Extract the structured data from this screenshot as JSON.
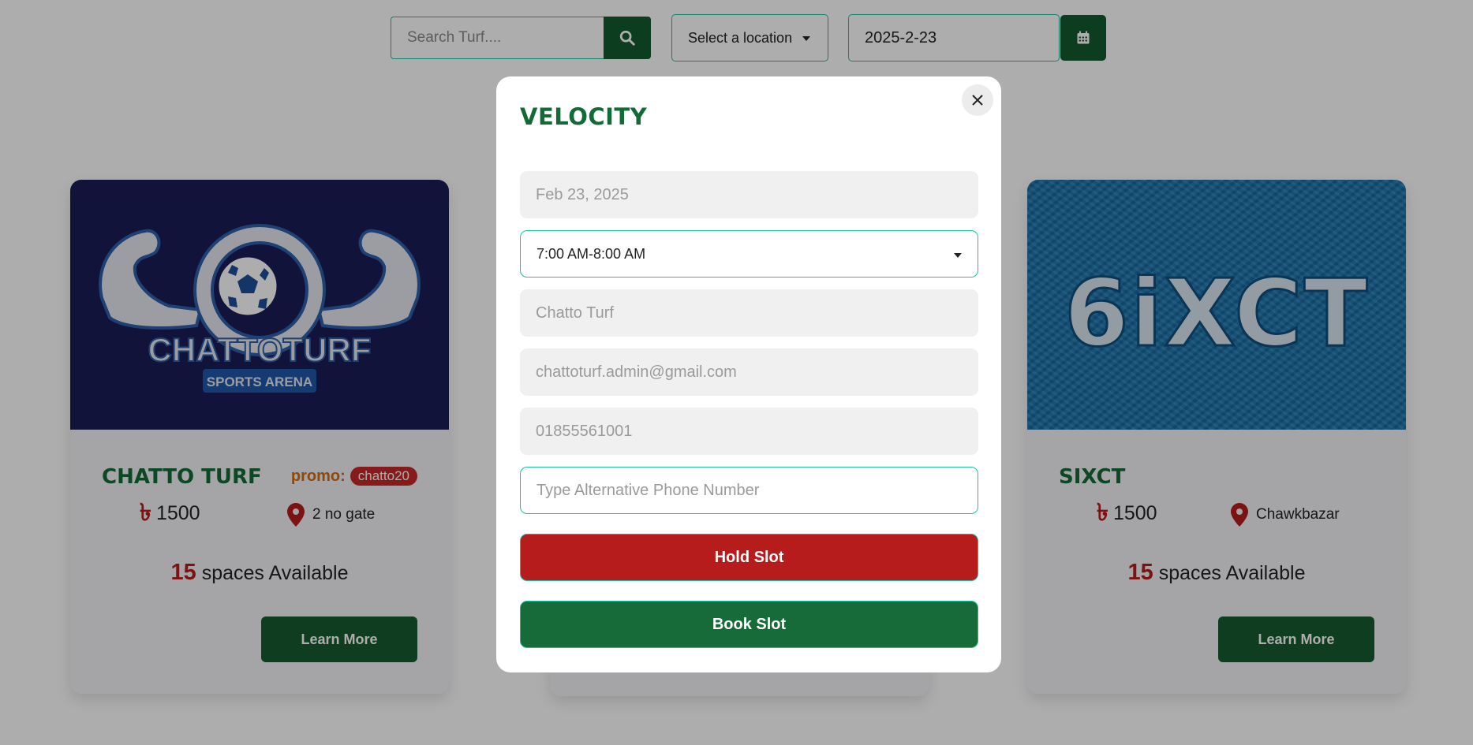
{
  "search": {
    "placeholder": "Search Turf...."
  },
  "filters": {
    "location_label": "Select a location",
    "date_value": "2025-2-23"
  },
  "cards": [
    {
      "title": "CHATTO TURF",
      "promo_label": "promo:",
      "promo_code": "chatto20",
      "price": "1500",
      "location": "2 no gate",
      "spaces_count": "15",
      "spaces_text": "spaces Available",
      "button": "Learn More",
      "logo_text_main": "CHATTOTURF",
      "logo_text_sub": "SPORTS ARENA"
    },
    {
      "title": "SIXCT",
      "price": "1500",
      "location": "Chawkbazar",
      "spaces_count": "15",
      "spaces_text": "spaces Available",
      "button": "Learn More",
      "logo_text_main": "6iXCT"
    }
  ],
  "modal": {
    "title": "VELOCITY",
    "date": "Feb 23, 2025",
    "time_slot": "7:00 AM-8:00 AM",
    "turf_name": "Chatto Turf",
    "email": "chattoturf.admin@gmail.com",
    "phone": "01855561001",
    "alt_phone_placeholder": "Type Alternative Phone Number",
    "hold_button": "Hold Slot",
    "book_button": "Book Slot"
  },
  "icons": {
    "currency": "৳",
    "search": "search-icon",
    "calendar": "calendar-icon",
    "location": "map-pin-icon",
    "close": "close-icon"
  },
  "colors": {
    "brand_green": "#136a36",
    "accent_teal": "#1ebfa0",
    "danger_red": "#b71c1c",
    "promo_orange": "#d26a12"
  }
}
